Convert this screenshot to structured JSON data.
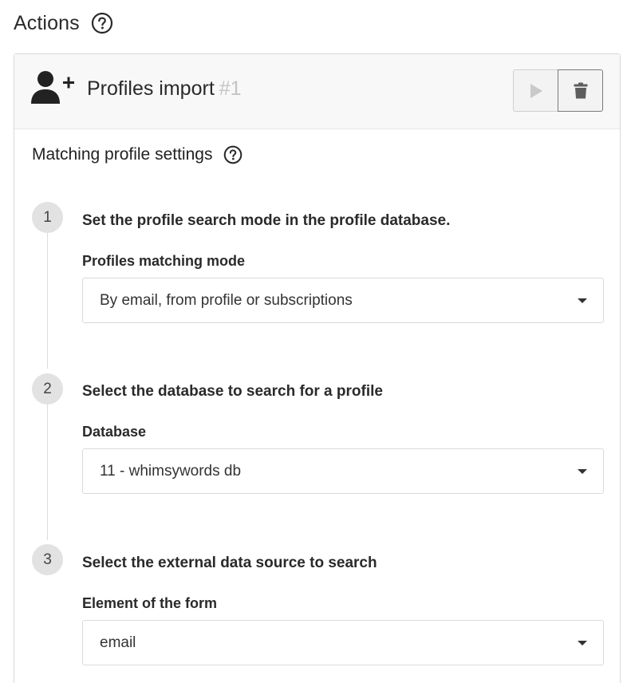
{
  "header": {
    "title": "Actions"
  },
  "card": {
    "title": "Profiles import",
    "number": "#1"
  },
  "section": {
    "title": "Matching profile settings"
  },
  "steps": [
    {
      "number": "1",
      "heading": "Set the profile search mode in the profile database.",
      "label": "Profiles matching mode",
      "value": "By email, from profile or subscriptions"
    },
    {
      "number": "2",
      "heading": "Select the database to search for a profile",
      "label": "Database",
      "value": "11 - whimsywords db"
    },
    {
      "number": "3",
      "heading": "Select the external data source to search",
      "label": "Element of the form",
      "value": "email"
    }
  ],
  "icons": {
    "help": "question-circle-icon",
    "profile": "user-plus-icon",
    "run": "play-icon",
    "delete": "trash-icon",
    "dropdown": "caret-down-icon"
  },
  "colors": {
    "card_header_bg": "#f7f8f7",
    "step_circle_bg": "#e2e2e2",
    "muted_number": "#c4c4c4"
  }
}
